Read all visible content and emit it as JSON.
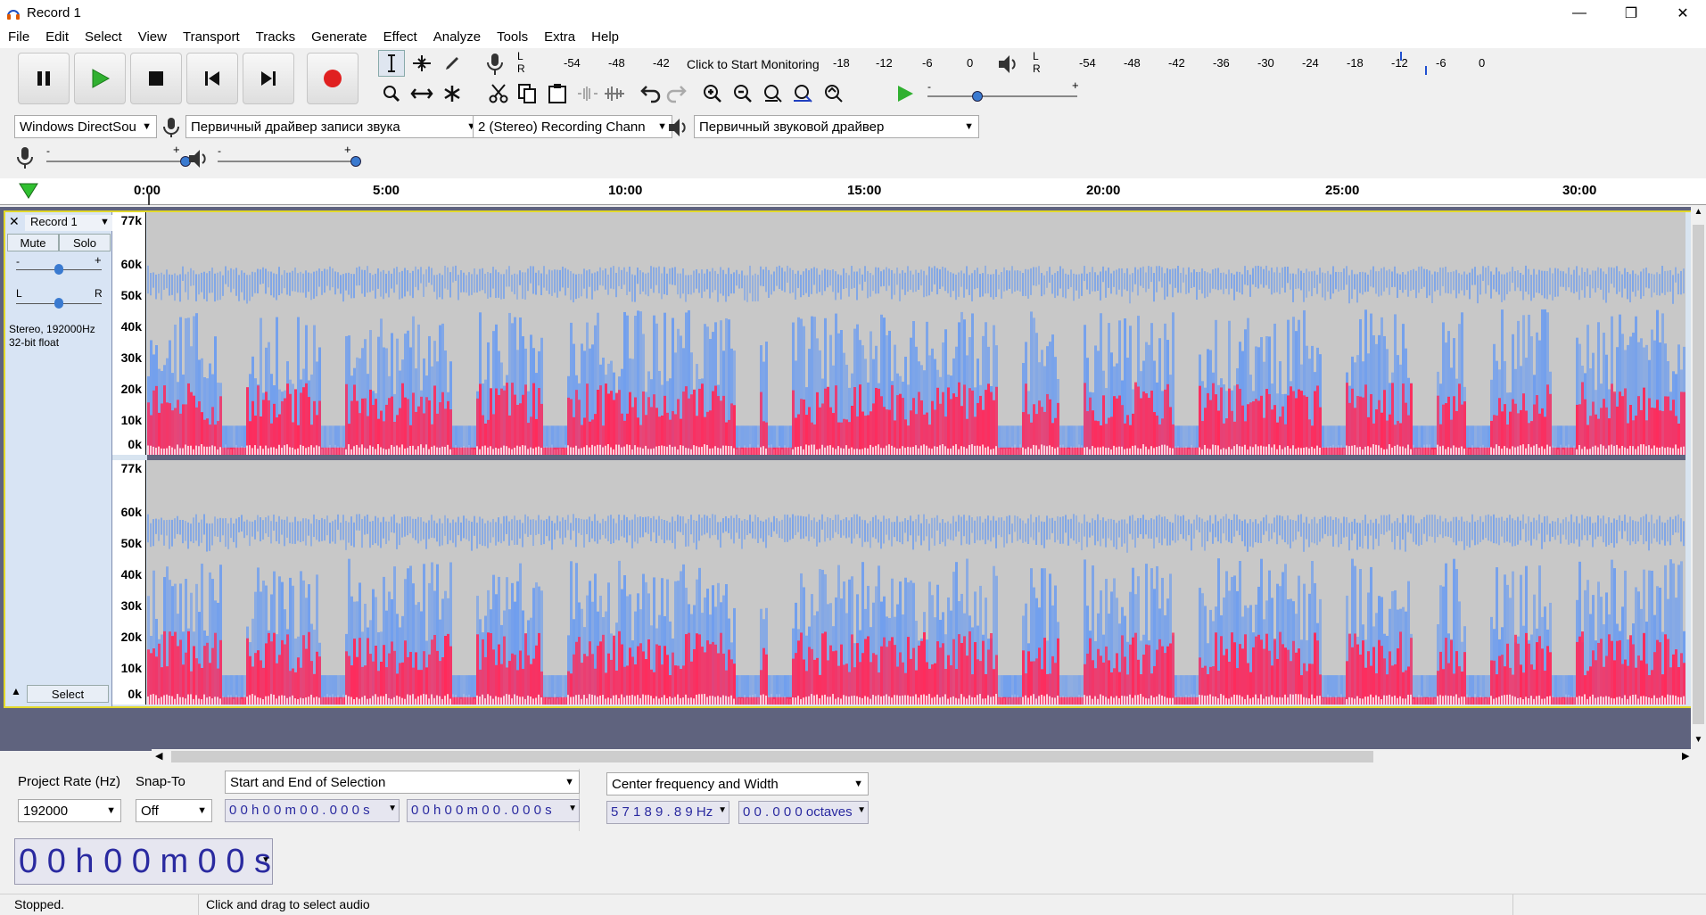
{
  "window": {
    "title": "Record 1",
    "minimize": "—",
    "maximize": "❐",
    "close": "✕"
  },
  "menu": [
    "File",
    "Edit",
    "Select",
    "View",
    "Transport",
    "Tracks",
    "Generate",
    "Effect",
    "Analyze",
    "Tools",
    "Extra",
    "Help"
  ],
  "meters": {
    "record_scale": [
      "-54",
      "-48",
      "-42",
      "-18",
      "-12",
      "-6",
      "0"
    ],
    "record_hint": "Click to Start Monitoring",
    "play_scale": [
      "-54",
      "-48",
      "-42",
      "-36",
      "-30",
      "-24",
      "-18",
      "-12",
      "-6",
      "0"
    ],
    "channel_L": "L",
    "channel_R": "R"
  },
  "play_speed": {
    "minus": "-",
    "plus": "+"
  },
  "device": {
    "host": "Windows DirectSou",
    "recording_device": "Первичный драйвер записи звука",
    "channels": "2 (Stereo) Recording Chann",
    "playback_device": "Первичный звуковой драйвер"
  },
  "mixer": {
    "minus": "-",
    "plus": "+"
  },
  "ruler": {
    "labels": [
      "0:00",
      "5:00",
      "10:00",
      "15:00",
      "20:00",
      "25:00",
      "30:00"
    ]
  },
  "track": {
    "name": "Record 1",
    "mute": "Mute",
    "solo": "Solo",
    "gain_minus": "-",
    "gain_plus": "+",
    "pan_left": "L",
    "pan_right": "R",
    "info_line1": "Stereo, 192000Hz",
    "info_line2": "32-bit float",
    "select": "Select",
    "freq_labels": [
      "77k",
      "60k",
      "50k",
      "40k",
      "30k",
      "20k",
      "10k",
      "0k"
    ],
    "colors": {
      "spectrogram_low": "#ff2a5a",
      "spectrogram_mid": "#6b9cf0",
      "background": "#c8c8c8",
      "selection_border": "#e2d82a"
    }
  },
  "selection_toolbar": {
    "project_rate_label": "Project Rate (Hz)",
    "project_rate": "192000",
    "snap_label": "Snap-To",
    "snap_value": "Off",
    "selection_mode": "Start and End of Selection",
    "start_time": "0 0 h 0 0 m 0 0 . 0 0 0 s",
    "end_time": "0 0 h 0 0 m 0 0 . 0 0 0 s"
  },
  "spectral": {
    "mode": "Center frequency and Width",
    "center": "5 7 1 8 9 . 8 9  Hz",
    "width": "0 0 . 0 0 0  octaves"
  },
  "time_display": "0 0  h  0 0  m  0 0  s",
  "status": {
    "state": "Stopped.",
    "hint": "Click and drag to select audio"
  }
}
